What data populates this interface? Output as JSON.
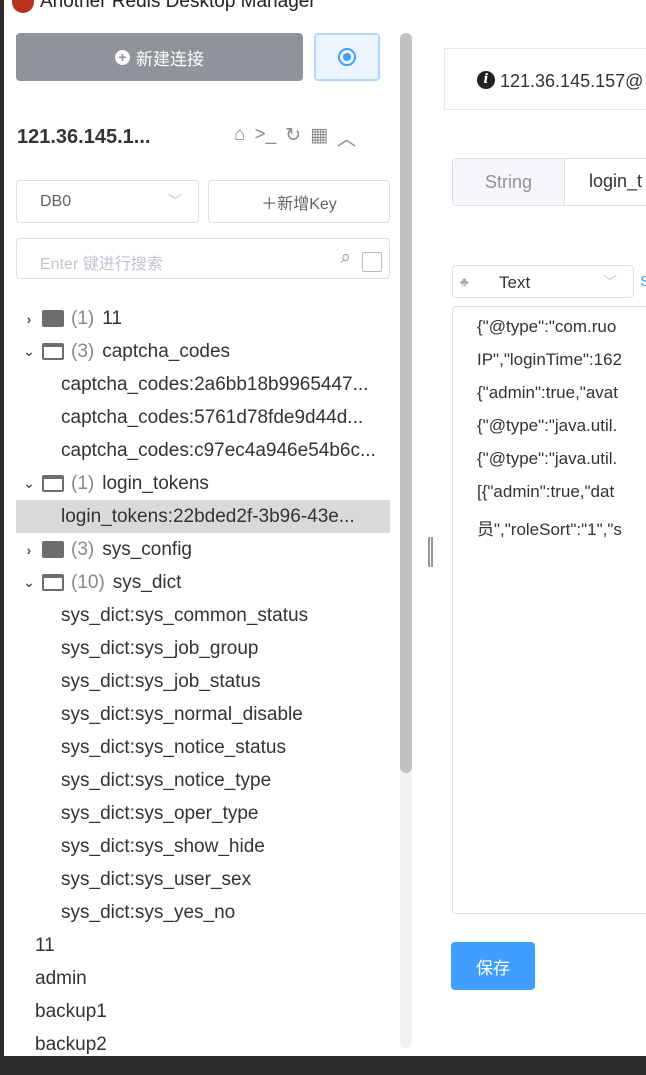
{
  "window": {
    "title": "Another Redis Desktop Manager"
  },
  "sidebar": {
    "new_connection_label": "新建连接",
    "connection_name": "121.36.145.1...",
    "db_select": "DB0",
    "add_key_label": "＋新增Key",
    "search_placeholder": "Enter 键进行搜索",
    "tree": [
      {
        "type": "folder",
        "open": false,
        "count": "(1)",
        "label": "11"
      },
      {
        "type": "folder",
        "open": true,
        "count": "(3)",
        "label": "captcha_codes"
      },
      {
        "type": "key",
        "label": "captcha_codes:2a6bb18b9965447..."
      },
      {
        "type": "key",
        "label": "captcha_codes:5761d78fde9d44d..."
      },
      {
        "type": "key",
        "label": "captcha_codes:c97ec4a946e54b6c..."
      },
      {
        "type": "folder",
        "open": true,
        "count": "(1)",
        "label": "login_tokens"
      },
      {
        "type": "key",
        "label": "login_tokens:22bded2f-3b96-43e...",
        "selected": true
      },
      {
        "type": "folder",
        "open": false,
        "count": "(3)",
        "label": "sys_config"
      },
      {
        "type": "folder",
        "open": true,
        "count": "(10)",
        "label": "sys_dict"
      },
      {
        "type": "key",
        "label": "sys_dict:sys_common_status"
      },
      {
        "type": "key",
        "label": "sys_dict:sys_job_group"
      },
      {
        "type": "key",
        "label": "sys_dict:sys_job_status"
      },
      {
        "type": "key",
        "label": "sys_dict:sys_normal_disable"
      },
      {
        "type": "key",
        "label": "sys_dict:sys_notice_status"
      },
      {
        "type": "key",
        "label": "sys_dict:sys_notice_type"
      },
      {
        "type": "key",
        "label": "sys_dict:sys_oper_type"
      },
      {
        "type": "key",
        "label": "sys_dict:sys_show_hide"
      },
      {
        "type": "key",
        "label": "sys_dict:sys_user_sex"
      },
      {
        "type": "key",
        "label": "sys_dict:sys_yes_no"
      },
      {
        "type": "root",
        "label": "11"
      },
      {
        "type": "root",
        "label": "admin"
      },
      {
        "type": "root",
        "label": "backup1"
      },
      {
        "type": "root",
        "label": "backup2"
      }
    ]
  },
  "main": {
    "tab_label": "121.36.145.157@",
    "key_type": "String",
    "key_name": "login_t",
    "format": "Text",
    "format_link": "S",
    "value_lines": [
      "{\"@type\":\"com.ruo",
      "IP\",\"loginTime\":162",
      "{\"admin\":true,\"avat",
      "{\"@type\":\"java.util.",
      "{\"@type\":\"java.util.",
      "[{\"admin\":true,\"dat",
      "员\",\"roleSort\":\"1\",\"s"
    ],
    "save_label": "保存"
  },
  "colors": {
    "primary": "#409eff",
    "selected_row": "#d9d9d9",
    "new_conn_button": "#909399"
  }
}
